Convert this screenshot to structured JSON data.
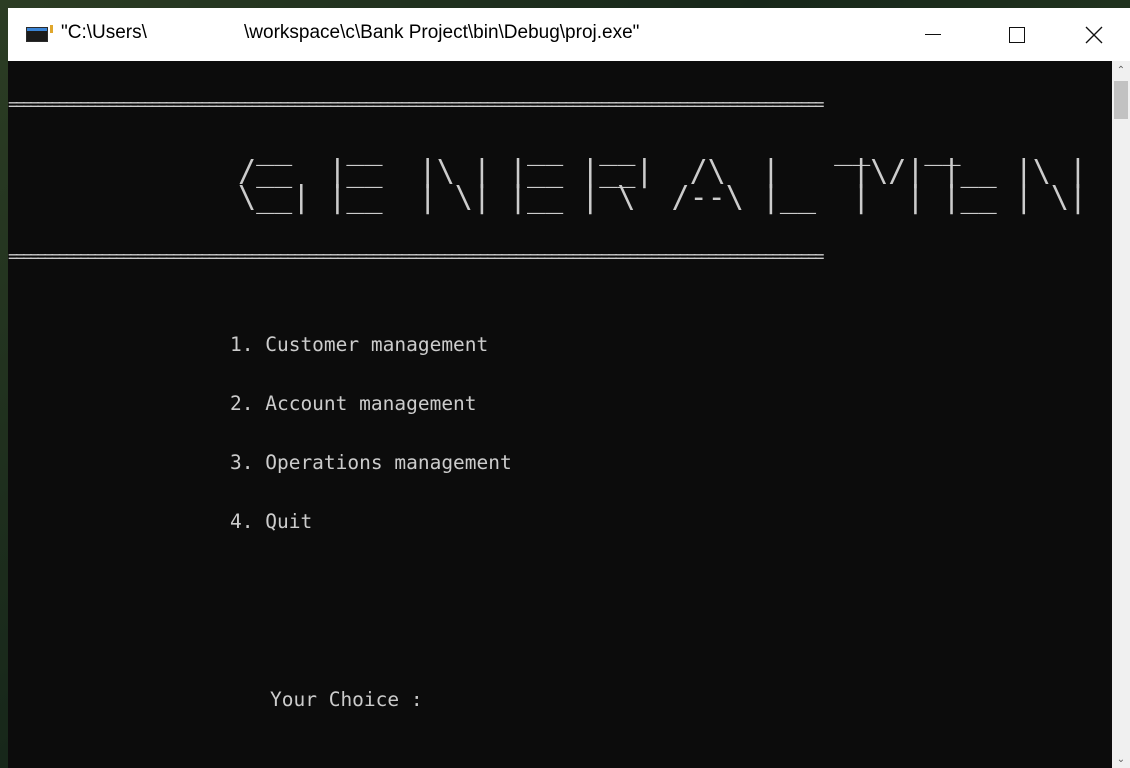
{
  "window": {
    "title_part1": "\"C:\\Users\\",
    "title_part2": "\\workspace\\c\\Bank Project\\bin\\Debug\\proj.exe\"",
    "controls": {
      "minimize": "—",
      "maximize": "☐",
      "close": "✕"
    }
  },
  "console": {
    "separator_top": "==================================================================================================================",
    "banner_line1": "  __   __        __  __           __   __",
    "banner_line2": " /__  |__  |\\ | |__ |__|  /\\  |    |\\/| |__ |\\ | |  |",
    "banner_line3": " \\__| |__  | \\| |__ | \\  /--\\ |__  |  | |__ | \\| |__|",
    "separator_bottom": "==================================================================================================================",
    "menu_items": [
      "1. Customer management",
      "2. Account management",
      "3. Operations management",
      "4. Quit"
    ],
    "prompt": "Your Choice :"
  },
  "scrollbar": {
    "up_arrow": "⌃",
    "down_arrow": "⌄"
  }
}
